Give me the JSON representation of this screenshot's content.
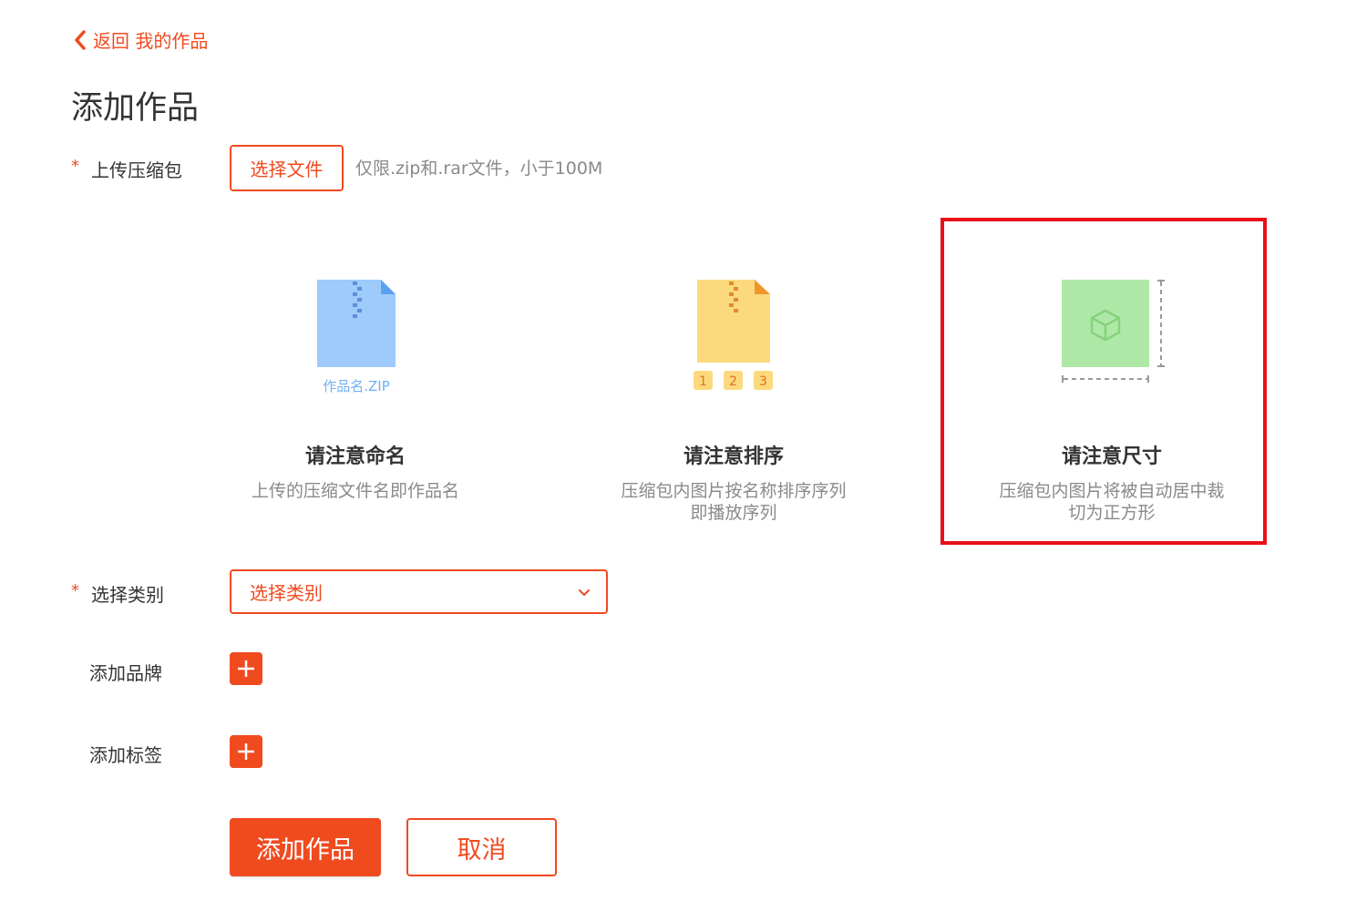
{
  "nav": {
    "back_label": "返回 我的作品"
  },
  "page": {
    "title": "添加作品"
  },
  "upload": {
    "required_mark": "*",
    "label": "上传压缩包",
    "button_label": "选择文件",
    "hint": "仅限.zip和.rar文件，小于100M"
  },
  "tips": [
    {
      "title": "请注意命名",
      "desc_lines": [
        "上传的压缩文件名即作品名"
      ],
      "icon": "zip-file-icon",
      "icon_caption": "作品名.ZIP"
    },
    {
      "title": "请注意排序",
      "desc_lines": [
        "压缩包内图片按名称排序序列",
        "即播放序列"
      ],
      "icon": "zip-sequence-icon",
      "sequence_numbers": [
        "1",
        "2",
        "3"
      ]
    },
    {
      "title": "请注意尺寸",
      "desc_lines": [
        "压缩包内图片将被自动居中裁",
        "切为正方形"
      ],
      "icon": "square-crop-icon"
    }
  ],
  "category": {
    "required_mark": "*",
    "label": "选择类别",
    "selected": "选择类别"
  },
  "brand": {
    "label": "添加品牌"
  },
  "tag": {
    "label": "添加标签"
  },
  "actions": {
    "submit_label": "添加作品",
    "cancel_label": "取消"
  },
  "colors": {
    "accent": "#f04a1f",
    "highlight": "#e8101a",
    "muted_text": "#8a8a8a",
    "blue_file": "#9ecbfb",
    "yellow_file": "#fdd97e",
    "green_square": "#aee8a6"
  }
}
